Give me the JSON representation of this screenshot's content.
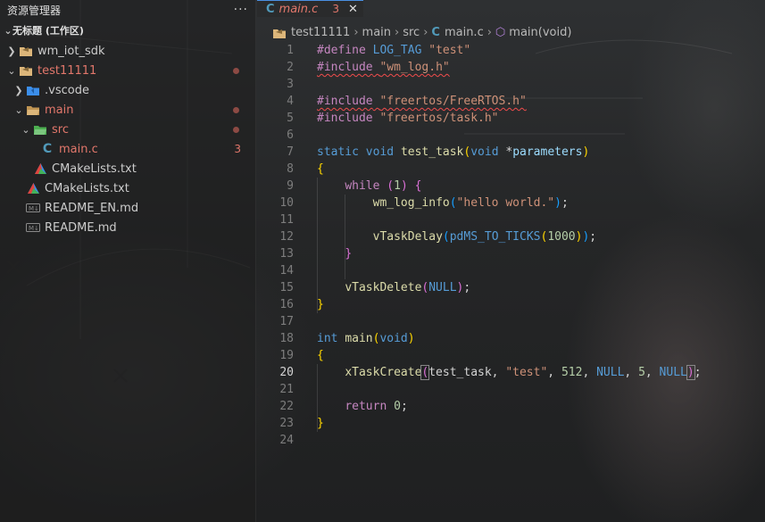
{
  "sidebar": {
    "title": "资源管理器",
    "more": "···",
    "workspace": "无标题 (工作区)",
    "items": [
      {
        "label": "wm_iot_sdk",
        "depth": 0,
        "chev": "right",
        "icon": "folder-yellow-icon"
      },
      {
        "label": "test11111",
        "depth": 0,
        "chev": "down",
        "icon": "folder-yellow-icon",
        "modified": true
      },
      {
        "label": ".vscode",
        "depth": 1,
        "chev": "right",
        "icon": "folder-blue-icon"
      },
      {
        "label": "main",
        "depth": 1,
        "chev": "down",
        "icon": "folder-open-icon",
        "modified": true
      },
      {
        "label": "src",
        "depth": 2,
        "chev": "down",
        "icon": "folder-green-icon",
        "modified": true
      },
      {
        "label": "main.c",
        "depth": 3,
        "chev": "none",
        "icon": "c-file-icon",
        "count": "3"
      },
      {
        "label": "CMakeLists.txt",
        "depth": 2,
        "chev": "none",
        "icon": "cmake-icon"
      },
      {
        "label": "CMakeLists.txt",
        "depth": 1,
        "chev": "none",
        "icon": "cmake-icon"
      },
      {
        "label": "README_EN.md",
        "depth": 1,
        "chev": "none",
        "icon": "markdown-icon"
      },
      {
        "label": "README.md",
        "depth": 1,
        "chev": "none",
        "icon": "markdown-icon"
      }
    ]
  },
  "tab": {
    "name": "main.c",
    "problems": "3",
    "close": "✕"
  },
  "breadcrumb": [
    "test11111",
    "main",
    "src",
    "main.c",
    "main(void)"
  ],
  "code": {
    "active_line": 20,
    "line_count": 24
  },
  "colors": {
    "accent": "#4a90e2",
    "modified": "#e2776b"
  }
}
